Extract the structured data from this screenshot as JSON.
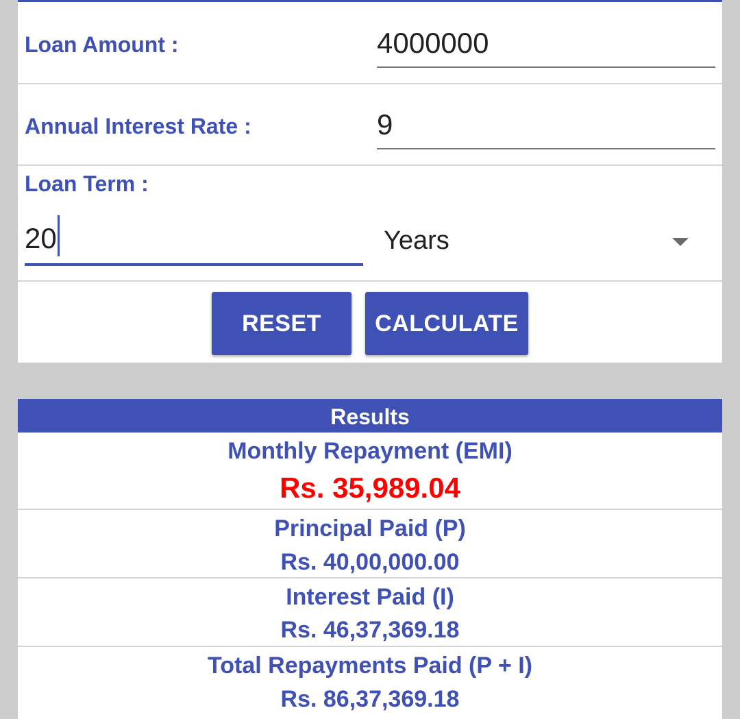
{
  "form": {
    "loan_amount": {
      "label": "Loan Amount :",
      "value": "4000000"
    },
    "interest_rate": {
      "label": "Annual Interest Rate :",
      "value": "9"
    },
    "loan_term": {
      "label": "Loan Term :",
      "value": "20",
      "unit": "Years"
    },
    "reset_label": "RESET",
    "calculate_label": "CALCULATE"
  },
  "results": {
    "header": "Results",
    "emi": {
      "title": "Monthly Repayment (EMI)",
      "value": "Rs. 35,989.04"
    },
    "principal": {
      "title": "Principal Paid (P)",
      "value": "Rs. 40,00,000.00"
    },
    "interest": {
      "title": "Interest Paid (I)",
      "value": "Rs. 46,37,369.18"
    },
    "total": {
      "title": "Total Repayments Paid (P + I)",
      "value": "Rs. 86,37,369.18"
    }
  },
  "colors": {
    "accent": "#3f51b5",
    "emi_highlight": "#ff0000",
    "background": "#cccccc"
  },
  "icons": {
    "term_unit_dropdown": "chevron-down-icon"
  }
}
